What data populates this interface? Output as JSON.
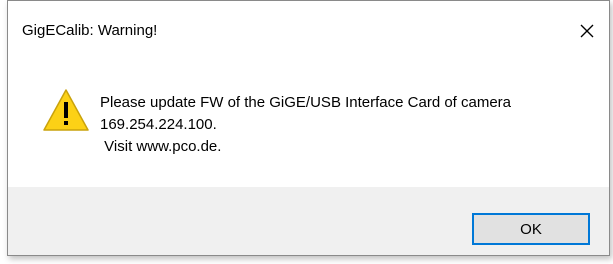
{
  "window": {
    "title": "GigECalib: Warning!",
    "close_icon": "close-icon"
  },
  "message": {
    "icon": "warning-icon",
    "lines": [
      "Please update FW of the GiGE/USB Interface Card of camera",
      "169.254.224.100.",
      " Visit www.pco.de."
    ]
  },
  "buttons": {
    "ok_label": "OK"
  },
  "colors": {
    "accent": "#0078d7",
    "warning_fill": "#fcd116",
    "footer_bg": "#f0f0f0"
  }
}
